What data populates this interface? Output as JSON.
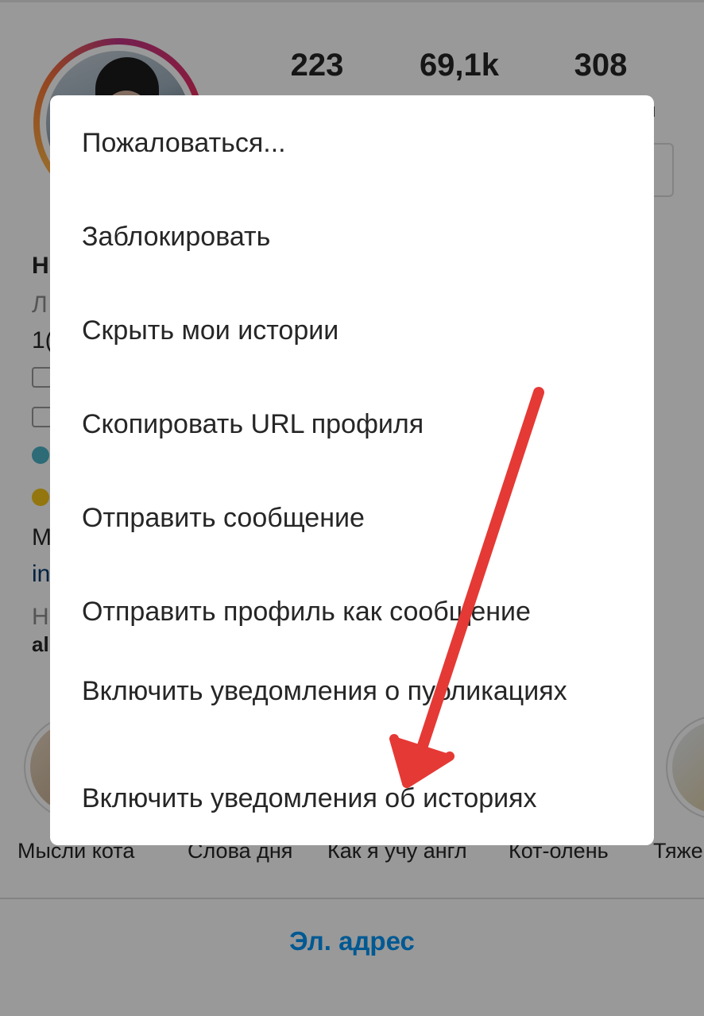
{
  "profile": {
    "stats": {
      "posts": "223",
      "followers": "69,1k",
      "following": "308",
      "partial_label": "и"
    },
    "bio": {
      "name_fragment": "Н",
      "category_fragment": "Л",
      "line3_fragment": "1(",
      "line8_fragment": "М",
      "link_fragment": "in",
      "line10_fragment": "Н",
      "line11_fragment": "al"
    }
  },
  "highlights": {
    "labels": [
      "Мысли кота",
      "Слова дня",
      "Как я учу англ",
      "Кот-олень",
      "Тяже"
    ]
  },
  "email_button": "Эл. адрес",
  "menu": {
    "items": [
      "Пожаловаться...",
      "Заблокировать",
      "Скрыть мои истории",
      "Скопировать URL профиля",
      "Отправить сообщение",
      "Отправить профиль как сообщение",
      "Включить уведомления о публикациях",
      "Включить уведомления об историях"
    ]
  },
  "colors": {
    "accent_link": "#0095f6",
    "annotation_arrow": "#e53935",
    "overlay": "rgba(0,0,0,0.4)"
  },
  "icons": {
    "annotation": "red-arrow-icon"
  }
}
